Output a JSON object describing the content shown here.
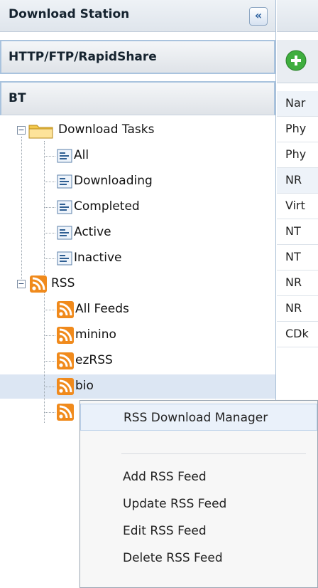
{
  "header": {
    "title": "Download Station",
    "collapse_glyph": "«"
  },
  "accordion": {
    "http_label": "HTTP/FTP/RapidShare",
    "bt_label": "BT"
  },
  "tree": {
    "download_tasks": {
      "label": "Download Tasks",
      "expander": "−",
      "children": [
        "All",
        "Downloading",
        "Completed",
        "Active",
        "Inactive"
      ]
    },
    "rss": {
      "label": "RSS",
      "expander": "−",
      "children": [
        "All Feeds",
        "minino",
        "ezRSS",
        "bio",
        ""
      ]
    }
  },
  "right_panel": {
    "rows": [
      "Nar",
      "Phy",
      "Phy",
      "NR",
      "Virt",
      "NT",
      "NT",
      "NR",
      "NR",
      "CDk"
    ]
  },
  "context_menu": {
    "items": [
      "RSS Download Manager",
      "Add RSS Feed",
      "Update RSS Feed",
      "Edit RSS Feed",
      "Delete RSS Feed"
    ]
  },
  "colors": {
    "selection": "#dce6f3",
    "rss_orange": "#f08a1c",
    "folder_yellow": "#f3c84b"
  }
}
